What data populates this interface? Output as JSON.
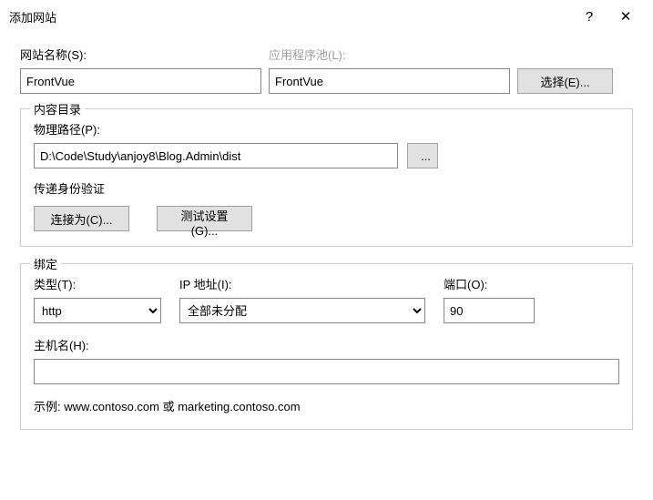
{
  "titlebar": {
    "title": "添加网站",
    "help": "?",
    "close": "✕"
  },
  "top": {
    "sitename_label": "网站名称(S):",
    "sitename_value": "FrontVue",
    "apppool_label": "应用程序池(L):",
    "apppool_value": "FrontVue",
    "select_btn": "选择(E)..."
  },
  "content": {
    "legend": "内容目录",
    "path_label": "物理路径(P):",
    "path_value": "D:\\Code\\Study\\anjoy8\\Blog.Admin\\dist",
    "browse_btn": "...",
    "passthru_label": "传递身份验证",
    "connect_as_btn": "连接为(C)...",
    "test_btn": "测试设置(G)..."
  },
  "binding": {
    "legend": "绑定",
    "type_label": "类型(T):",
    "type_value": "http",
    "ip_label": "IP 地址(I):",
    "ip_value": "全部未分配",
    "port_label": "端口(O):",
    "port_value": "90",
    "hostname_label": "主机名(H):",
    "hostname_value": "",
    "example": "示例: www.contoso.com 或 marketing.contoso.com"
  }
}
